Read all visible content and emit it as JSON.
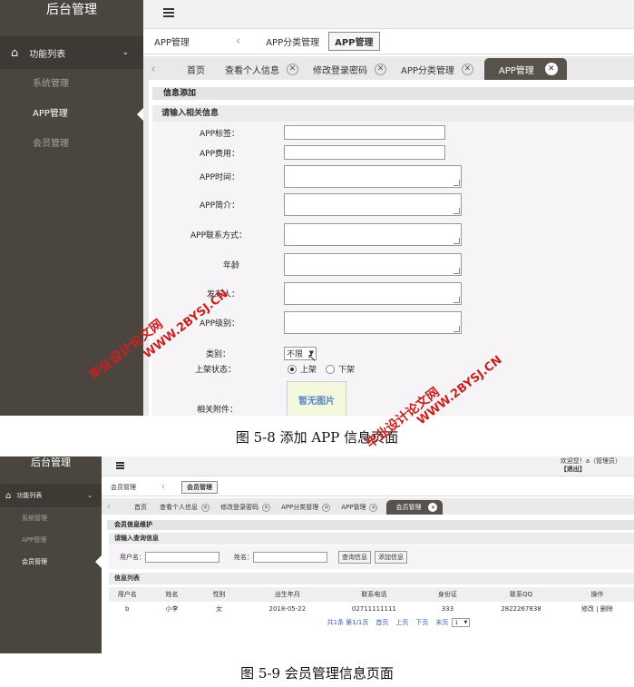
{
  "fig1": {
    "brand": "后台管理",
    "menu_head": "功能列表",
    "menu_items": [
      "系统管理",
      "APP管理",
      "会员管理"
    ],
    "crumbs": {
      "home": "APP管理",
      "parent": "APP分类管理",
      "current": "APP管理"
    },
    "tabs": [
      "首页",
      "查看个人信息",
      "修改登录密码",
      "APP分类管理",
      "APP管理"
    ],
    "panel_title": "信息添加",
    "sub_title": "请输入相关信息",
    "fields": {
      "tag": "APP标签：",
      "fee": "APP费用：",
      "time": "APP时间：",
      "intro": "APP简介：",
      "contact": "APP联系方式：",
      "age": "年龄",
      "publisher": "发布人：",
      "level": "APP级别：",
      "category": "类别：",
      "shelf": "上架状态：",
      "attachment": "相关附件："
    },
    "category_value": "不限",
    "shelf_options": [
      "上架",
      "下架"
    ],
    "shelf_selected": "上架",
    "attachment_placeholder": "暂无图片"
  },
  "caption1": "图 5-8 添加 APP 信息页面",
  "fig2": {
    "brand": "后台管理",
    "welcome": "欢迎您！a（管理员）",
    "logout": "【退出】",
    "menu_head": "功能列表",
    "menu_items": [
      "系统管理",
      "APP管理",
      "会员管理"
    ],
    "crumbs": {
      "home": "会员管理",
      "current": "会员管理"
    },
    "tabs": [
      "首页",
      "查看个人信息",
      "修改登录密码",
      "APP分类管理",
      "APP管理",
      "会员管理"
    ],
    "panel_title": "会员信息维护",
    "query_title": "请输入查询信息",
    "username_label": "用户名：",
    "name_label": "姓名：",
    "query_btn": "查询信息",
    "add_btn": "添加信息",
    "list_title": "信息列表",
    "columns": [
      "用户名",
      "姓名",
      "性别",
      "出生年月",
      "联系电话",
      "身份证",
      "联系QQ",
      "操作"
    ],
    "rows": [
      [
        "b",
        "小李",
        "女",
        "2018-05-22",
        "02711111111",
        "333",
        "2822267838"
      ]
    ],
    "row_actions": [
      "修改",
      "删除"
    ],
    "pager": [
      "共1条",
      "第1/1页",
      "首页",
      "上页",
      "下页",
      "末页"
    ],
    "page_select": "1"
  },
  "caption2": "图 5-9 会员管理信息页面",
  "watermarks": [
    "毕业设计论文网",
    "WWW.2BYSJ.CN"
  ],
  "colors": {
    "sidebar": "#4b4540",
    "active_tab": "#58524c",
    "watermark": "#c9211e"
  }
}
